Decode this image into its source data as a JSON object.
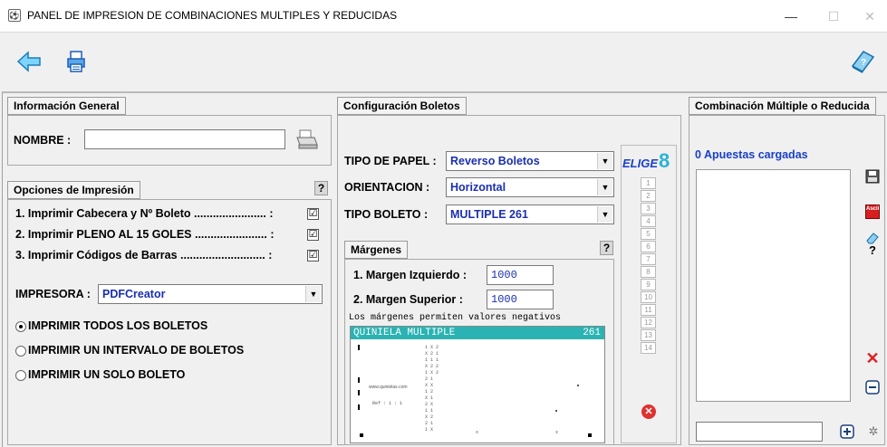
{
  "window": {
    "title": "PANEL DE IMPRESION DE COMBINACIONES MULTIPLES Y REDUCIDAS",
    "minimize": "—",
    "maximize": "☐",
    "close": "✕"
  },
  "toolbar": {
    "back_icon": "back-arrow-icon",
    "print_icon": "printer-icon",
    "help_icon": "help-book-icon"
  },
  "general": {
    "tab": "Información General",
    "name_label": "NOMBRE :",
    "name_value": ""
  },
  "options": {
    "tab": "Opciones de Impresión",
    "help": "?",
    "items": [
      {
        "label": "1. Imprimir Cabecera y Nº Boleto ....................... :",
        "checked": "☑"
      },
      {
        "label": "2. Imprimir PLENO AL 15 GOLES ....................... :",
        "checked": "☑"
      },
      {
        "label": "3. Imprimir Códigos de Barras ........................... :",
        "checked": "☑"
      }
    ],
    "printer_label": "IMPRESORA :",
    "printer_value": "PDFCreator",
    "radios": [
      {
        "label": "IMPRIMIR TODOS LOS BOLETOS",
        "selected": true
      },
      {
        "label": "IMPRIMIR UN INTERVALO DE BOLETOS",
        "selected": false
      },
      {
        "label": "IMPRIMIR UN SOLO BOLETO",
        "selected": false
      }
    ]
  },
  "config": {
    "tab": "Configuración Boletos",
    "paper_label": "TIPO DE PAPEL :",
    "paper_value": "Reverso Boletos",
    "orient_label": "ORIENTACION  :",
    "orient_value": "Horizontal",
    "ticket_label": "TIPO BOLETO  :",
    "ticket_value": "MULTIPLE 261",
    "margins_tab": "Márgenes",
    "margins_help": "?",
    "left_margin_label": "1. Margen Izquierdo :",
    "left_margin_value": "1000",
    "top_margin_label": "2. Margen Superior  :",
    "top_margin_value": "1000",
    "margins_note": "Los márgenes permiten valores negativos",
    "preview_title": "QUINIELA MULTIPLE",
    "preview_number": "261",
    "preview_site": "www.quinielas.com",
    "elige_logo": "ELIGE",
    "elige_number": "8",
    "numbers": [
      "1",
      "2",
      "3",
      "4",
      "5",
      "6",
      "7",
      "8",
      "9",
      "10",
      "11",
      "12",
      "13",
      "14"
    ]
  },
  "combination": {
    "tab": "Combinación Múltiple o Reducida",
    "status": "0 Apuestas cargadas",
    "side_help": "?",
    "ascii_label": "Ascii"
  },
  "colors": {
    "accent_blue": "#1a2fb0",
    "preview_header": "#2bb3b3",
    "delete_red": "#e02020"
  }
}
